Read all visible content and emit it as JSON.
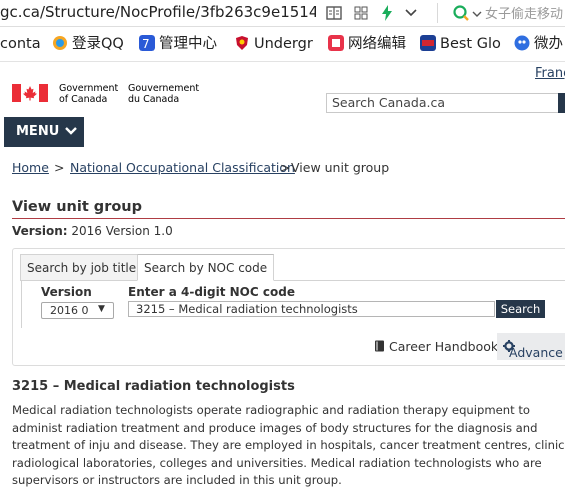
{
  "browser": {
    "url": "gc.ca/Structure/NocProfile/3fb263c9e1514",
    "search_placeholder": "女子偷走移动"
  },
  "bookmarks": [
    {
      "label": "conta",
      "icon": "none"
    },
    {
      "label": "登录QQ",
      "icon": "qq-icon"
    },
    {
      "label": "管理中心",
      "icon": "manage-icon"
    },
    {
      "label": "Undergr",
      "icon": "shield-icon"
    },
    {
      "label": "网络编辑",
      "icon": "edit-icon"
    },
    {
      "label": "Best Glo",
      "icon": "usnews-icon"
    },
    {
      "label": "微办",
      "icon": "baidu-icon"
    }
  ],
  "header": {
    "lang_toggle": "Franç",
    "gov_en_line1": "Government",
    "gov_en_line2": "of Canada",
    "gov_fr_line1": "Gouvernement",
    "gov_fr_line2": "du Canada",
    "search_placeholder": "Search Canada.ca",
    "menu_label": "MENU"
  },
  "breadcrumb": {
    "home": "Home",
    "sep1": ">",
    "noc": "National Occupational Classification",
    "sep2": ">",
    "current": "View unit group"
  },
  "main": {
    "title": "View unit group",
    "version_label": "Version:",
    "version_value": "2016 Version 1.0",
    "tabs": [
      "Search by job title",
      "Search by NOC code"
    ],
    "version_field_label": "Version",
    "version_selected": "2016 0",
    "noc_field_label": "Enter a 4-digit NOC code",
    "noc_input_value": "3215 – Medical radiation technologists",
    "search_button": "Search",
    "career_handbook": "Career Handbook",
    "advanced": "Advance",
    "noc_title": "3215 – Medical radiation technologists",
    "description": "Medical radiation technologists operate radiographic and radiation therapy equipment to administ radiation treatment and produce images of body structures for the diagnosis and treatment of inju and disease. They are employed in hospitals, cancer treatment centres, clinics, radiological laboratories, colleges and universities. Medical radiation technologists who are supervisors or instructors are included in this unit group."
  },
  "colors": {
    "navy": "#26374a",
    "link": "#284162",
    "accent_rule": "#af3c43",
    "flag_red": "#eb2d37"
  }
}
